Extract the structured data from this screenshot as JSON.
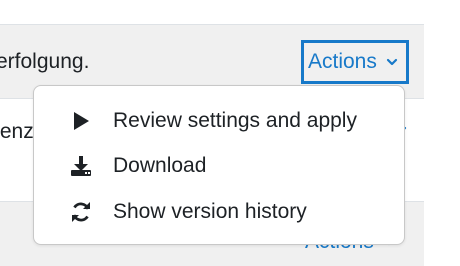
{
  "header": {
    "text": "erfolgung.",
    "actions_label": "Actions"
  },
  "row": {
    "text": "tenz"
  },
  "footer": {
    "actions_label": "Actions"
  },
  "menu": {
    "items": [
      {
        "label": "Review settings and apply",
        "icon": "play-icon"
      },
      {
        "label": "Download",
        "icon": "download-icon"
      },
      {
        "label": "Show version history",
        "icon": "history-icon"
      }
    ]
  },
  "colors": {
    "accent": "#1779c9",
    "header_bg": "#f0f0f0",
    "text": "#1d2125"
  }
}
